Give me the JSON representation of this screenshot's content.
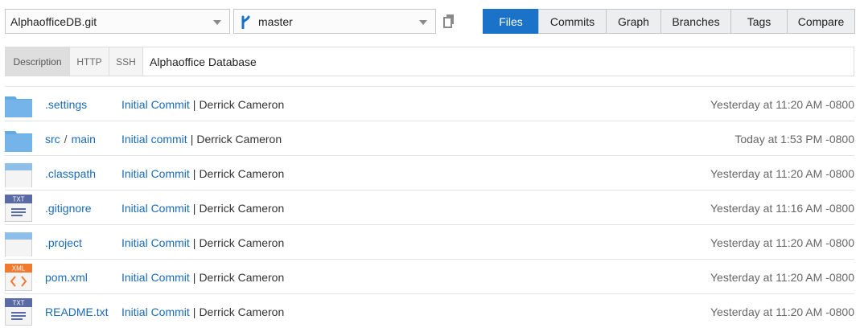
{
  "repo_select": {
    "value": "AlphaofficeDB.git",
    "icon": "chevron-down-icon"
  },
  "branch_select": {
    "value": "master",
    "icon": "branch-icon"
  },
  "copy": {
    "icon": "copy-icon"
  },
  "nav_tabs": [
    {
      "label": "Files",
      "active": true
    },
    {
      "label": "Commits",
      "active": false
    },
    {
      "label": "Graph",
      "active": false
    },
    {
      "label": "Branches",
      "active": false
    },
    {
      "label": "Tags",
      "active": false
    },
    {
      "label": "Compare",
      "active": false
    }
  ],
  "clone_bar": {
    "tabs": [
      {
        "label": "Description",
        "active": true
      },
      {
        "label": "HTTP",
        "active": false
      },
      {
        "label": "SSH",
        "active": false
      }
    ],
    "value": "Alphaoffice Database"
  },
  "files": [
    {
      "icon": "folder-icon",
      "name": ".settings",
      "commit": "Initial Commit",
      "author": "Derrick Cameron",
      "time": "Yesterday at 11:20 AM -0800"
    },
    {
      "icon": "folder-icon",
      "name": "src",
      "name2": "main",
      "commit": "Initial commit",
      "author": "Derrick Cameron",
      "time": "Today at 1:53 PM -0800"
    },
    {
      "icon": "file-icon",
      "name": ".classpath",
      "commit": "Initial Commit",
      "author": "Derrick Cameron",
      "time": "Yesterday at 11:20 AM -0800"
    },
    {
      "icon": "txt-file-icon",
      "name": ".gitignore",
      "commit": "Initial Commit",
      "author": "Derrick Cameron",
      "time": "Yesterday at 11:16 AM -0800"
    },
    {
      "icon": "file-icon",
      "name": ".project",
      "commit": "Initial Commit",
      "author": "Derrick Cameron",
      "time": "Yesterday at 11:20 AM -0800"
    },
    {
      "icon": "xml-file-icon",
      "name": "pom.xml",
      "commit": "Initial Commit",
      "author": "Derrick Cameron",
      "time": "Yesterday at 11:20 AM -0800"
    },
    {
      "icon": "txt-file-icon",
      "name": "README.txt",
      "commit": "Initial Commit",
      "author": "Derrick Cameron",
      "time": "Yesterday at 11:20 AM -0800"
    }
  ],
  "icon_labels": {
    "txt": "TXT",
    "xml": "XML"
  },
  "colors": {
    "accent": "#1a73c8",
    "link": "#1a6bb8",
    "folder": "#64a9e0",
    "xml": "#f07a2f",
    "txt": "#5a6aa5"
  }
}
